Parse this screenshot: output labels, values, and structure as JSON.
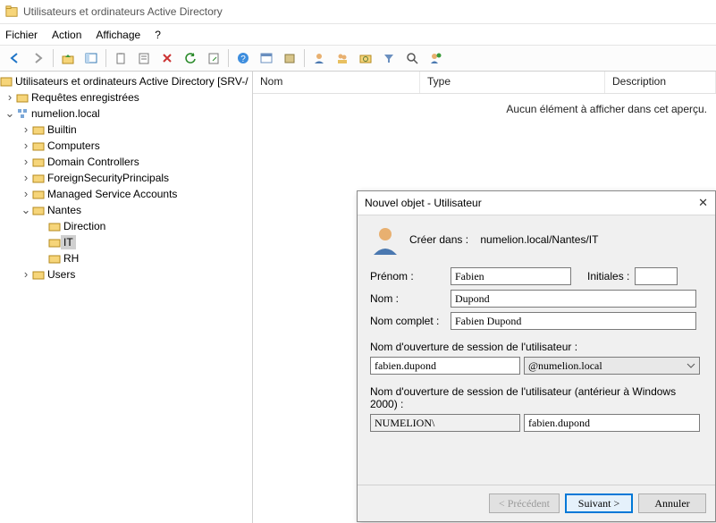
{
  "title": "Utilisateurs et ordinateurs Active Directory",
  "menu": {
    "file": "Fichier",
    "action": "Action",
    "view": "Affichage",
    "help": "?"
  },
  "tree": {
    "root": "Utilisateurs et ordinateurs Active Directory [SRV-/",
    "saved": "Requêtes enregistrées",
    "domain": "numelion.local",
    "nodes": {
      "builtin": "Builtin",
      "computers": "Computers",
      "dc": "Domain Controllers",
      "fsp": "ForeignSecurityPrincipals",
      "msa": "Managed Service Accounts",
      "nantes": "Nantes",
      "direction": "Direction",
      "it": "IT",
      "rh": "RH",
      "users": "Users"
    }
  },
  "list": {
    "cols": {
      "name": "Nom",
      "type": "Type",
      "desc": "Description"
    },
    "empty": "Aucun élément à afficher dans cet aperçu."
  },
  "dialog": {
    "title": "Nouvel objet - Utilisateur",
    "create_in_lbl": "Créer dans :",
    "create_in_path": "numelion.local/Nantes/IT",
    "first_lbl": "Prénom :",
    "first_val": "Fabien",
    "initials_lbl": "Initiales :",
    "initials_val": "",
    "last_lbl": "Nom :",
    "last_val": "Dupond",
    "full_lbl": "Nom complet :",
    "full_val": "Fabien Dupond",
    "logon_lbl": "Nom d'ouverture de session de l'utilisateur :",
    "logon_val": "fabien.dupond",
    "upn_suffix": "@numelion.local",
    "logon_legacy_lbl": "Nom d'ouverture de session de l'utilisateur (antérieur à Windows 2000) :",
    "netbios": "NUMELION\\",
    "sam": "fabien.dupond",
    "btn_prev": "< Précédent",
    "btn_next": "Suivant >",
    "btn_cancel": "Annuler"
  }
}
